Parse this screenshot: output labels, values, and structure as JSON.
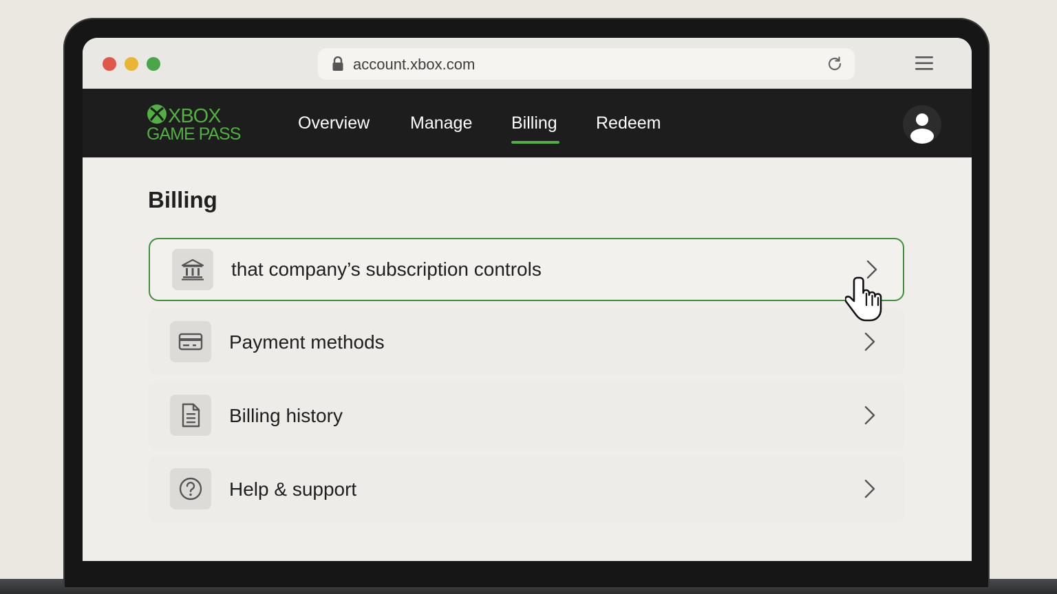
{
  "browser": {
    "url": "account.xbox.com"
  },
  "navbar": {
    "logo_line1": "XBOX",
    "logo_line2": "GAME PASS",
    "items": [
      {
        "label": "Overview"
      },
      {
        "label": "Manage"
      },
      {
        "label": "Billing"
      },
      {
        "label": "Redeem"
      }
    ],
    "active_item": "Billing"
  },
  "page": {
    "title": "Billing",
    "cards": [
      {
        "label": "that company’s subscription controls",
        "icon": "bank-icon",
        "highlighted": true
      },
      {
        "label": "Payment methods",
        "icon": "credit-card-icon"
      },
      {
        "label": "Billing history",
        "icon": "document-icon"
      },
      {
        "label": "Help & support",
        "icon": "question-icon"
      }
    ]
  },
  "colors": {
    "accent_green": "#52b043",
    "navbar_bg": "#1d1d1d",
    "highlight_border": "#3e8e3a"
  }
}
